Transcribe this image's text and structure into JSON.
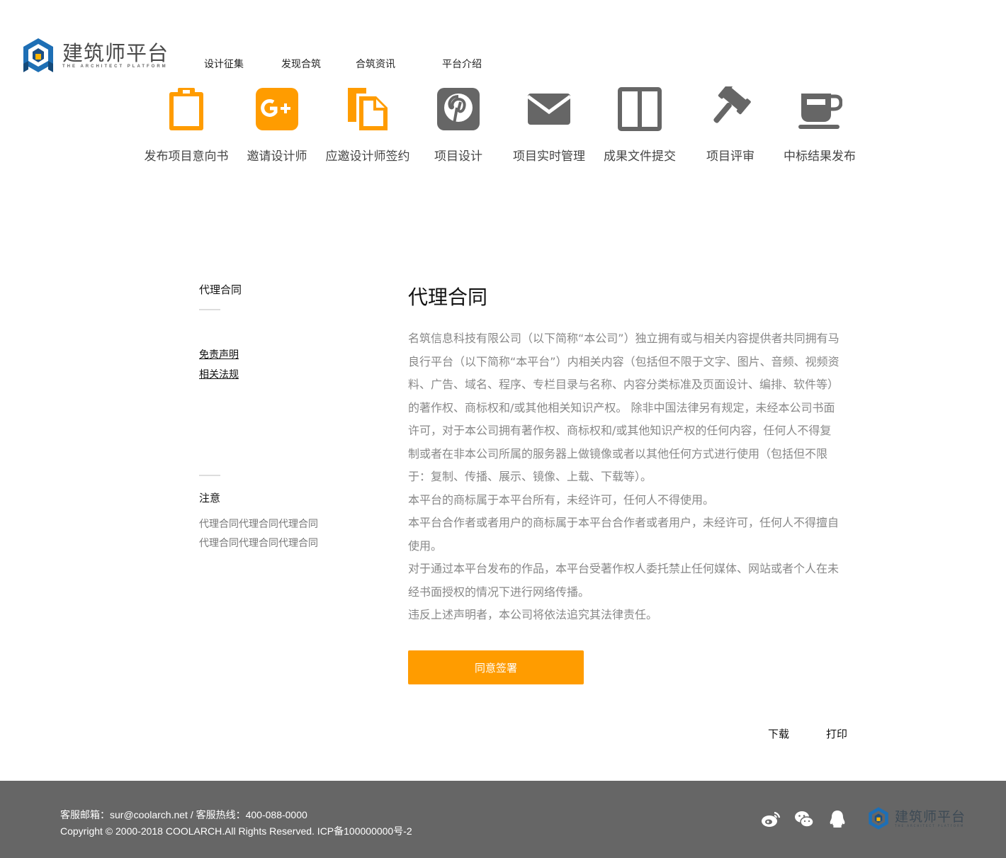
{
  "header": {
    "logo_cn": "建筑师平台",
    "logo_en": "THE ARCHITECT PLATFORM",
    "nav": [
      "设计征集",
      "发现合筑",
      "合筑资讯",
      "平台介绍"
    ]
  },
  "steps": [
    {
      "label": "发布项目意向书",
      "icon": "clipboard-icon"
    },
    {
      "label": "邀请设计师",
      "icon": "google-plus-icon"
    },
    {
      "label": "应邀设计师签约",
      "icon": "files-icon"
    },
    {
      "label": "项目设计",
      "icon": "pinterest-icon"
    },
    {
      "label": "项目实时管理",
      "icon": "envelope-icon"
    },
    {
      "label": "成果文件提交",
      "icon": "columns-icon"
    },
    {
      "label": "项目评审",
      "icon": "gavel-icon"
    },
    {
      "label": "中标结果发布",
      "icon": "coffee-cup-icon"
    }
  ],
  "sidebar": {
    "title": "代理合同",
    "links": [
      "免责声明",
      "相关法规"
    ],
    "note_title": "注意",
    "note_lines": [
      "代理合同代理合同代理合同",
      "代理合同代理合同代理合同"
    ]
  },
  "main": {
    "title": "代理合同",
    "lines": [
      "名筑信息科技有限公司（以下简称“本公司”）独立拥有或与相关内容提供者共同拥有马",
      "良行平台（以下简称“本平台”）内相关内容（包括但不限于文字、图片、音频、视频资",
      "料、广告、域名、程序、专栏目录与名称、内容分类标准及页面设计、编排、软件等）",
      "的著作权、商标权和/或其他相关知识产权。 除非中国法律另有规定，未经本公司书面",
      "许可，对于本公司拥有著作权、商标权和/或其他知识产权的任何内容，任何人不得复",
      "制或者在非本公司所属的服务器上做镜像或者以其他任何方式进行使用（包括但不限",
      "于：复制、传播、展示、镜像、上载、下载等）。",
      "本平台的商标属于本平台所有，未经许可，任何人不得使用。",
      "本平台合作者或者用户的商标属于本平台合作者或者用户，未经许可，任何人不得擅自",
      "使用。",
      "对于通过本平台发布的作品，本平台受著作权人委托禁止任何媒体、网站或者个人在未",
      "经书面授权的情况下进行网络传播。",
      "违反上述声明者，本公司将依法追究其法律责任。"
    ],
    "agree_button": "同意签署",
    "download": "下载",
    "print": "打印"
  },
  "footer": {
    "contact": "客服邮箱：sur@coolarch.net / 客服热线：400-088-0000",
    "copyright": "Copyright © 2000-2018 COOLARCH.All Rights Reserved.  ICP备100000000号-2",
    "social": [
      "weibo-icon",
      "wechat-icon",
      "qq-icon"
    ],
    "logo_cn": "建筑师平台",
    "logo_en": "THE ARCHITECT PLATFORM"
  },
  "colors": {
    "accent": "#ff9c00",
    "icon_gray": "#666666",
    "footer_bg": "#666666"
  }
}
